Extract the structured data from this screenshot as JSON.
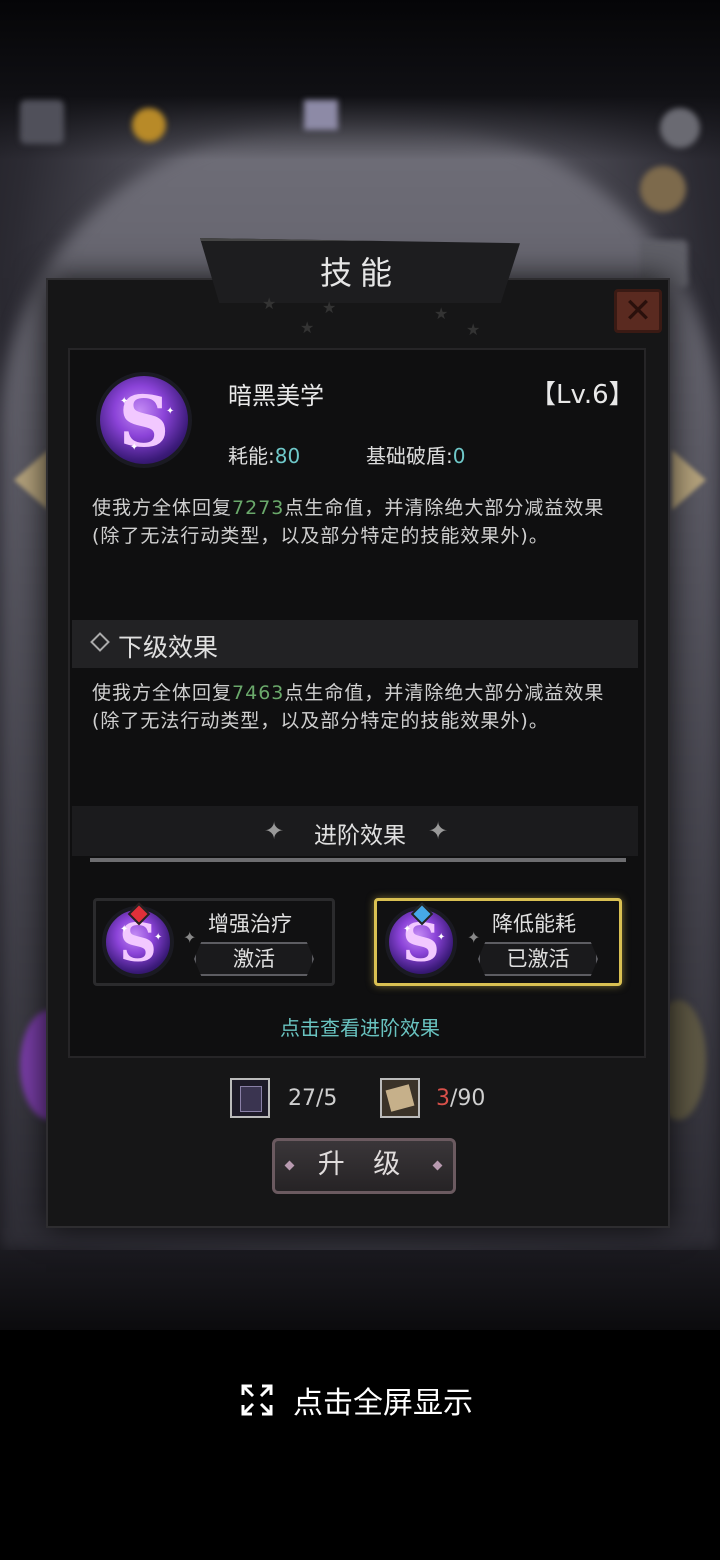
{
  "dialog": {
    "title": "技能",
    "close_icon": "close-icon"
  },
  "skill": {
    "name": "暗黑美学",
    "level": "【Lv.6】",
    "energy_label": "耗能:",
    "energy_value": "80",
    "break_label": "基础破盾:",
    "break_value": "0",
    "desc_prefix": "使我方全体回复",
    "desc_value": "7273",
    "desc_suffix": "点生命值，并清除绝大部分减益效果(除了无法行动类型，以及部分特定的技能效果外)。"
  },
  "next_level": {
    "title": "下级效果",
    "desc_prefix": "使我方全体回复",
    "desc_value": "7463",
    "desc_suffix": "点生命值，并清除绝大部分减益效果(除了无法行动类型，以及部分特定的技能效果外)。"
  },
  "advanced": {
    "title": "进阶效果",
    "cards": [
      {
        "title": "增强治疗",
        "button": "激活",
        "gem_color": "#e0303a",
        "active": false
      },
      {
        "title": "降低能耗",
        "button": "已激活",
        "gem_color": "#46a8e8",
        "active": true
      }
    ],
    "view_link": "点击查看进阶效果"
  },
  "resources": {
    "book_count": "27/5",
    "scroll_have": "3",
    "scroll_need": "/90"
  },
  "upgrade_label": "升 级",
  "fullscreen_label": "点击全屏显示",
  "colors": {
    "accent_teal": "#6fc8c9",
    "highlight_green": "#6aa96b",
    "active_border": "#d9c052",
    "alert_red": "#d8504a"
  }
}
